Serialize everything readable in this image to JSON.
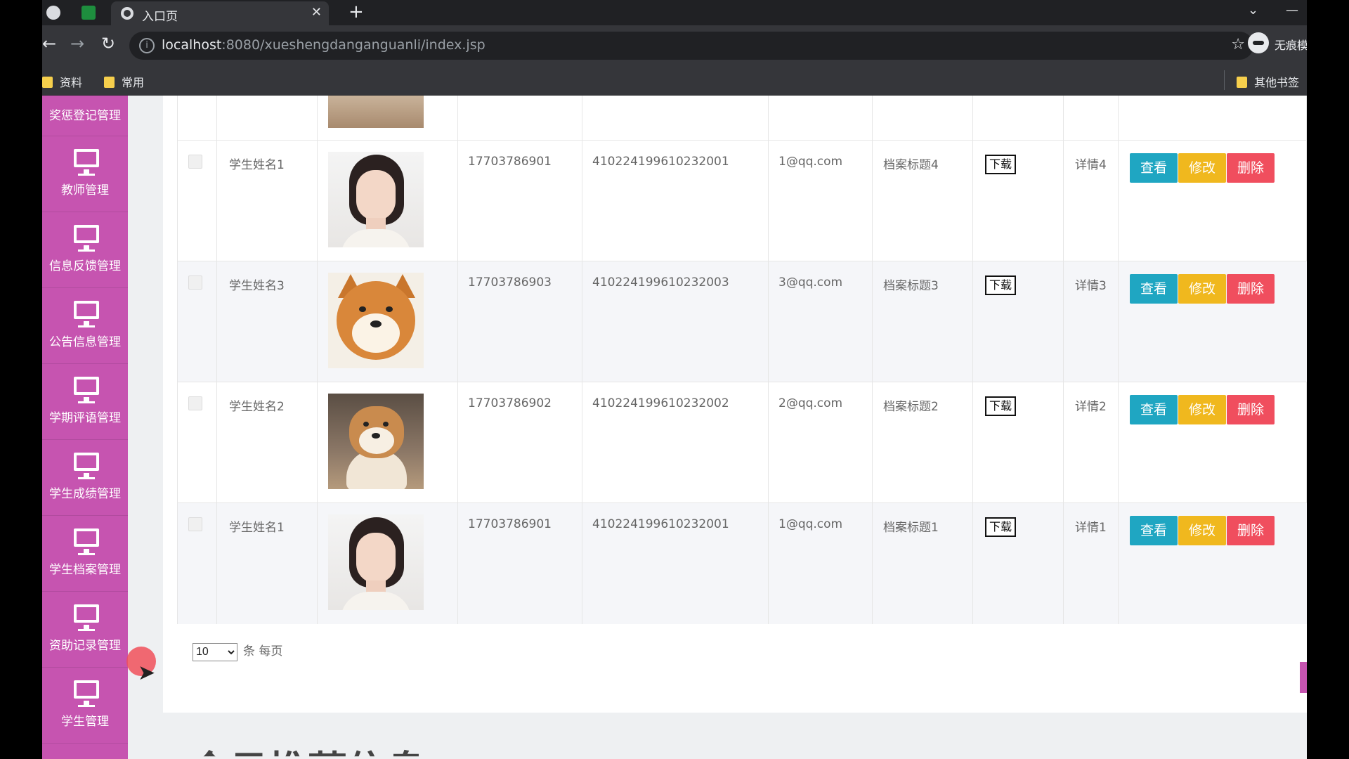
{
  "browser": {
    "tab_title": "入口页",
    "new_tab_symbol": "+",
    "tab_close_symbol": "✕",
    "url_host": "localhost",
    "url_path": ":8080/xueshengdanganguanli/index.jsp",
    "profile_label": "无痕模",
    "bookmarks": [
      "资料",
      "常用"
    ],
    "other_bookmarks": "其他书签",
    "chevron": "⌄",
    "minimize": "—"
  },
  "sidebar": {
    "top_partial": "奖惩登记管理",
    "items": [
      {
        "label": "教师管理"
      },
      {
        "label": "信息反馈管理"
      },
      {
        "label": "公告信息管理"
      },
      {
        "label": "学期评语管理"
      },
      {
        "label": "学生成绩管理"
      },
      {
        "label": "学生档案管理"
      },
      {
        "label": "资助记录管理"
      },
      {
        "label": "学生管理"
      }
    ]
  },
  "table": {
    "download_label": "下载",
    "view_label": "查看",
    "edit_label": "修改",
    "delete_label": "删除",
    "rows": [
      {
        "name": "学生姓名1",
        "photo": "woman-portrait",
        "phone": "17703786901",
        "id_number": "410224199610232001",
        "email": "1@qq.com",
        "archive_title": "档案标题4",
        "detail": "详情4"
      },
      {
        "name": "学生姓名3",
        "photo": "shiba-dog",
        "phone": "17703786903",
        "id_number": "410224199610232003",
        "email": "3@qq.com",
        "archive_title": "档案标题3",
        "detail": "详情3"
      },
      {
        "name": "学生姓名2",
        "photo": "shiba-dog-sitting",
        "phone": "17703786902",
        "id_number": "410224199610232002",
        "email": "2@qq.com",
        "archive_title": "档案标题2",
        "detail": "详情2"
      },
      {
        "name": "学生姓名1",
        "photo": "woman-portrait",
        "phone": "17703786901",
        "id_number": "410224199610232001",
        "email": "1@qq.com",
        "archive_title": "档案标题1",
        "detail": "详情1"
      }
    ]
  },
  "pager": {
    "page_size": "10",
    "per_page_label": "条 每页"
  },
  "footer_title_partial": "今日推荐信息"
}
